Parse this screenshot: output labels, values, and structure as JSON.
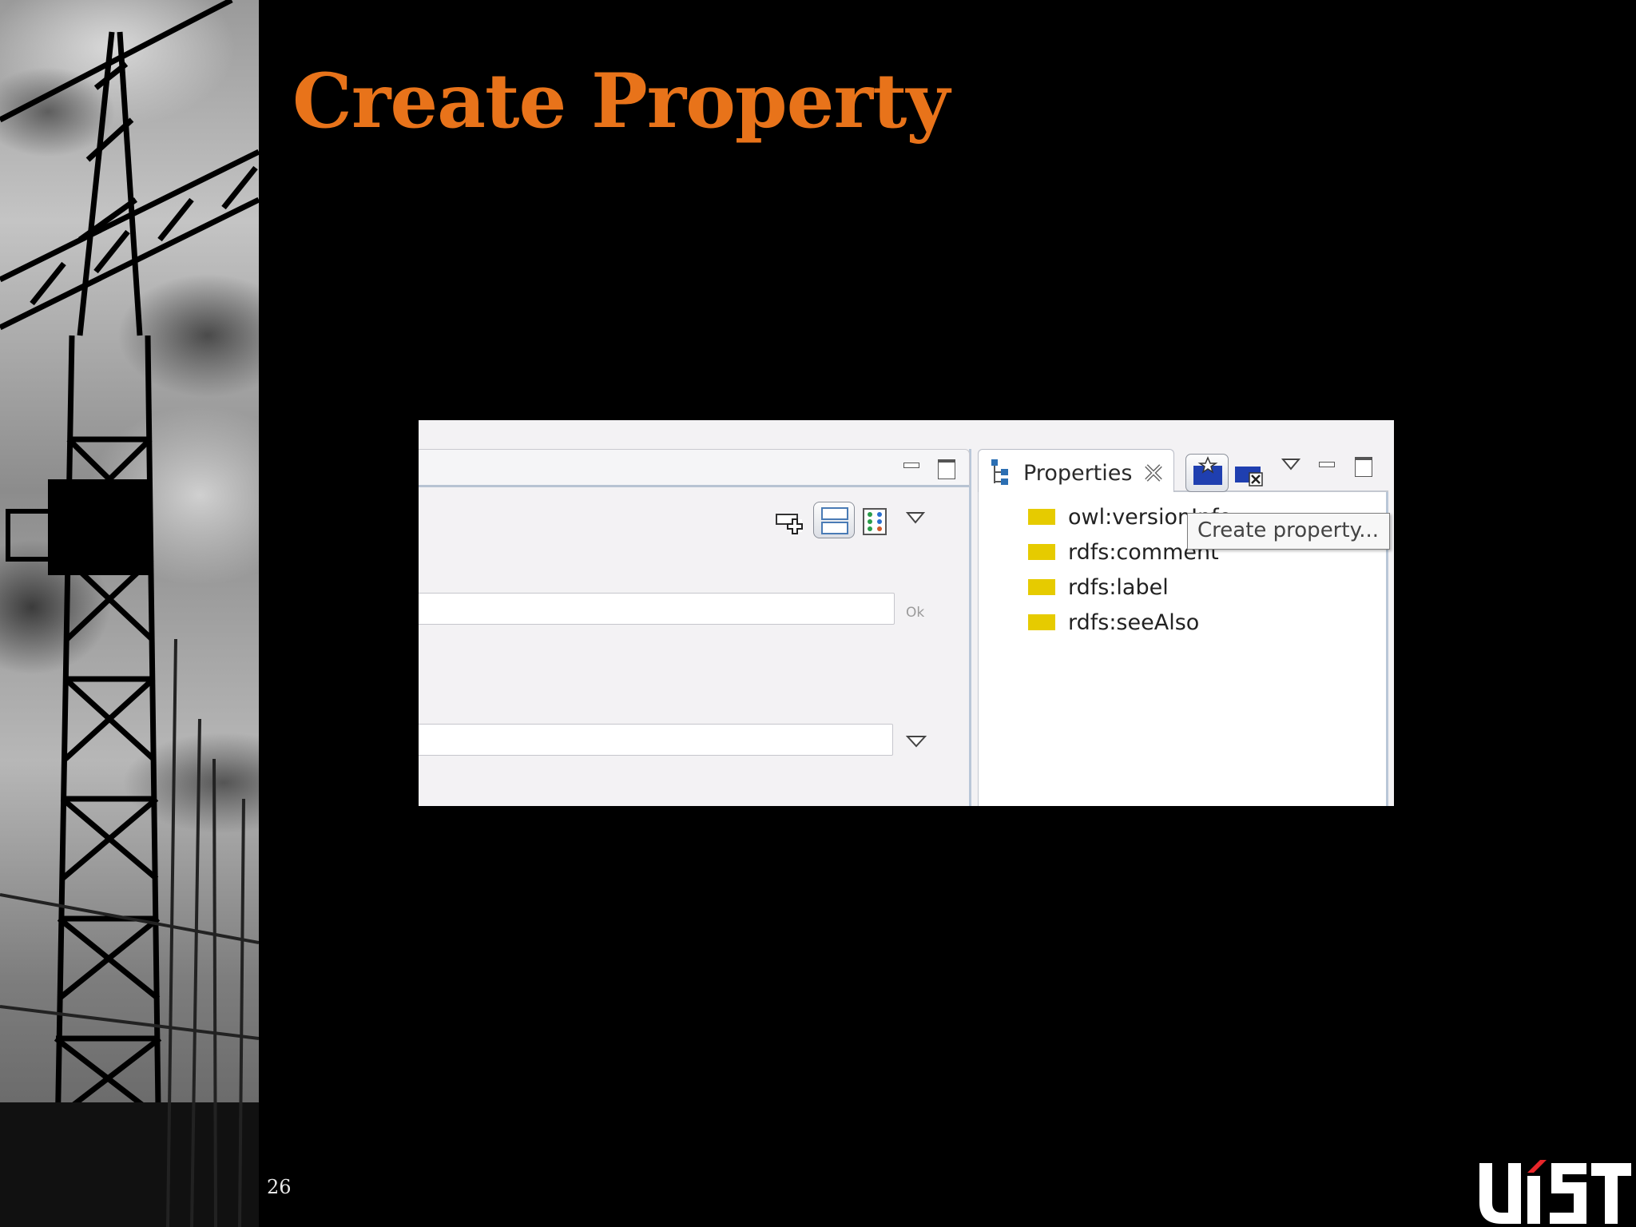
{
  "slide": {
    "title": "Create Property",
    "page_number": "26",
    "logo_text": "UST"
  },
  "editor": {
    "field_1_hint": "Ok",
    "icons": [
      "add-row-icon",
      "layout-icon",
      "palette-icon",
      "dropdown-arrow-icon"
    ]
  },
  "properties_view": {
    "tab_label": "Properties",
    "items": [
      {
        "label": "owl:versionInfo"
      },
      {
        "label": "rdfs:comment"
      },
      {
        "label": "rdfs:label"
      },
      {
        "label": "rdfs:seeAlso"
      }
    ],
    "tooltip": "Create property..."
  },
  "colors": {
    "title": "#e8731a",
    "swatch": "#e6cb00",
    "background": "#000000"
  }
}
